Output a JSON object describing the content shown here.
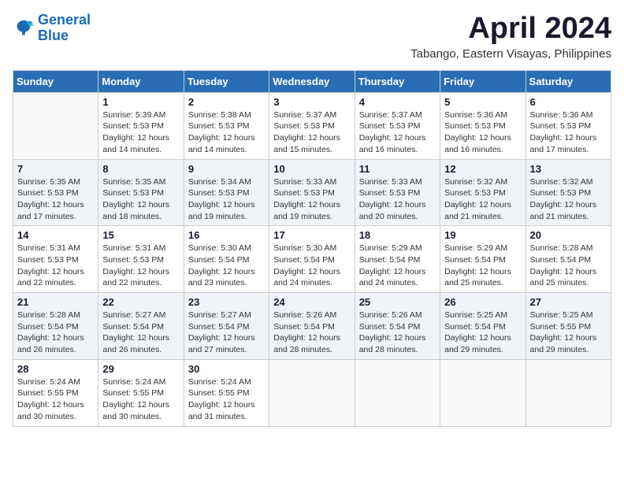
{
  "logo": {
    "line1": "General",
    "line2": "Blue"
  },
  "title": "April 2024",
  "subtitle": "Tabango, Eastern Visayas, Philippines",
  "weekdays": [
    "Sunday",
    "Monday",
    "Tuesday",
    "Wednesday",
    "Thursday",
    "Friday",
    "Saturday"
  ],
  "weeks": [
    [
      {
        "day": "",
        "info": ""
      },
      {
        "day": "1",
        "info": "Sunrise: 5:39 AM\nSunset: 5:53 PM\nDaylight: 12 hours\nand 14 minutes."
      },
      {
        "day": "2",
        "info": "Sunrise: 5:38 AM\nSunset: 5:53 PM\nDaylight: 12 hours\nand 14 minutes."
      },
      {
        "day": "3",
        "info": "Sunrise: 5:37 AM\nSunset: 5:53 PM\nDaylight: 12 hours\nand 15 minutes."
      },
      {
        "day": "4",
        "info": "Sunrise: 5:37 AM\nSunset: 5:53 PM\nDaylight: 12 hours\nand 16 minutes."
      },
      {
        "day": "5",
        "info": "Sunrise: 5:36 AM\nSunset: 5:53 PM\nDaylight: 12 hours\nand 16 minutes."
      },
      {
        "day": "6",
        "info": "Sunrise: 5:36 AM\nSunset: 5:53 PM\nDaylight: 12 hours\nand 17 minutes."
      }
    ],
    [
      {
        "day": "7",
        "info": "Sunrise: 5:35 AM\nSunset: 5:53 PM\nDaylight: 12 hours\nand 17 minutes."
      },
      {
        "day": "8",
        "info": "Sunrise: 5:35 AM\nSunset: 5:53 PM\nDaylight: 12 hours\nand 18 minutes."
      },
      {
        "day": "9",
        "info": "Sunrise: 5:34 AM\nSunset: 5:53 PM\nDaylight: 12 hours\nand 19 minutes."
      },
      {
        "day": "10",
        "info": "Sunrise: 5:33 AM\nSunset: 5:53 PM\nDaylight: 12 hours\nand 19 minutes."
      },
      {
        "day": "11",
        "info": "Sunrise: 5:33 AM\nSunset: 5:53 PM\nDaylight: 12 hours\nand 20 minutes."
      },
      {
        "day": "12",
        "info": "Sunrise: 5:32 AM\nSunset: 5:53 PM\nDaylight: 12 hours\nand 21 minutes."
      },
      {
        "day": "13",
        "info": "Sunrise: 5:32 AM\nSunset: 5:53 PM\nDaylight: 12 hours\nand 21 minutes."
      }
    ],
    [
      {
        "day": "14",
        "info": "Sunrise: 5:31 AM\nSunset: 5:53 PM\nDaylight: 12 hours\nand 22 minutes."
      },
      {
        "day": "15",
        "info": "Sunrise: 5:31 AM\nSunset: 5:53 PM\nDaylight: 12 hours\nand 22 minutes."
      },
      {
        "day": "16",
        "info": "Sunrise: 5:30 AM\nSunset: 5:54 PM\nDaylight: 12 hours\nand 23 minutes."
      },
      {
        "day": "17",
        "info": "Sunrise: 5:30 AM\nSunset: 5:54 PM\nDaylight: 12 hours\nand 24 minutes."
      },
      {
        "day": "18",
        "info": "Sunrise: 5:29 AM\nSunset: 5:54 PM\nDaylight: 12 hours\nand 24 minutes."
      },
      {
        "day": "19",
        "info": "Sunrise: 5:29 AM\nSunset: 5:54 PM\nDaylight: 12 hours\nand 25 minutes."
      },
      {
        "day": "20",
        "info": "Sunrise: 5:28 AM\nSunset: 5:54 PM\nDaylight: 12 hours\nand 25 minutes."
      }
    ],
    [
      {
        "day": "21",
        "info": "Sunrise: 5:28 AM\nSunset: 5:54 PM\nDaylight: 12 hours\nand 26 minutes."
      },
      {
        "day": "22",
        "info": "Sunrise: 5:27 AM\nSunset: 5:54 PM\nDaylight: 12 hours\nand 26 minutes."
      },
      {
        "day": "23",
        "info": "Sunrise: 5:27 AM\nSunset: 5:54 PM\nDaylight: 12 hours\nand 27 minutes."
      },
      {
        "day": "24",
        "info": "Sunrise: 5:26 AM\nSunset: 5:54 PM\nDaylight: 12 hours\nand 28 minutes."
      },
      {
        "day": "25",
        "info": "Sunrise: 5:26 AM\nSunset: 5:54 PM\nDaylight: 12 hours\nand 28 minutes."
      },
      {
        "day": "26",
        "info": "Sunrise: 5:25 AM\nSunset: 5:54 PM\nDaylight: 12 hours\nand 29 minutes."
      },
      {
        "day": "27",
        "info": "Sunrise: 5:25 AM\nSunset: 5:55 PM\nDaylight: 12 hours\nand 29 minutes."
      }
    ],
    [
      {
        "day": "28",
        "info": "Sunrise: 5:24 AM\nSunset: 5:55 PM\nDaylight: 12 hours\nand 30 minutes."
      },
      {
        "day": "29",
        "info": "Sunrise: 5:24 AM\nSunset: 5:55 PM\nDaylight: 12 hours\nand 30 minutes."
      },
      {
        "day": "30",
        "info": "Sunrise: 5:24 AM\nSunset: 5:55 PM\nDaylight: 12 hours\nand 31 minutes."
      },
      {
        "day": "",
        "info": ""
      },
      {
        "day": "",
        "info": ""
      },
      {
        "day": "",
        "info": ""
      },
      {
        "day": "",
        "info": ""
      }
    ]
  ]
}
